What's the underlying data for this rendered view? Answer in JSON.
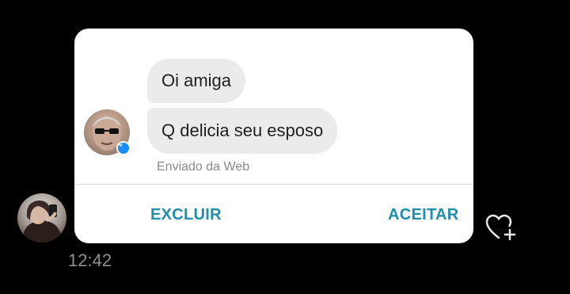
{
  "card": {
    "messages": [
      {
        "text": "Oi amiga"
      },
      {
        "text": "Q delicia seu esposo"
      }
    ],
    "sent_via": "Enviado da Web",
    "actions": {
      "delete_label": "EXCLUIR",
      "accept_label": "ACEITAR"
    }
  },
  "chat": {
    "timestamp": "12:42"
  },
  "colors": {
    "background": "#000000",
    "card_background": "#ffffff",
    "bubble_background": "#ebebeb",
    "action_color": "#1f8ea8",
    "timestamp_color": "#8e8e8e",
    "messenger_badge": "#1a8cf5"
  },
  "icons": {
    "sender_badge": "messenger-icon",
    "react": "heart-plus-icon"
  }
}
